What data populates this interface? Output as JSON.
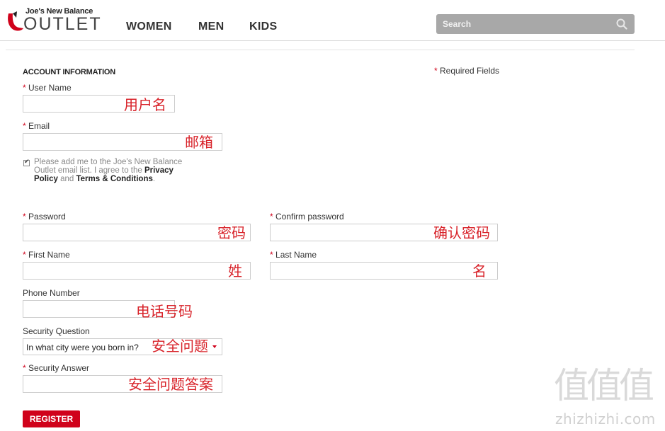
{
  "header": {
    "logo_top": "Joe's New Balance",
    "logo_bottom": "OUTLET",
    "nav": [
      "WOMEN",
      "MEN",
      "KIDS"
    ],
    "search_placeholder": "Search"
  },
  "form": {
    "section_title": "ACCOUNT INFORMATION",
    "required_note": "Required Fields",
    "required_marker": "*",
    "username": {
      "label": "User Name",
      "annotation": "用户名"
    },
    "email": {
      "label": "Email",
      "annotation": "邮箱"
    },
    "consent": {
      "text_1": "Please add me to the Joe's New Balance Outlet email list. I agree to the ",
      "privacy_link": "Privacy Policy",
      "and": " and ",
      "terms_link": "Terms & Conditions",
      "end": ".",
      "checked": true
    },
    "password": {
      "label": "Password",
      "annotation": "密码"
    },
    "confirm_password": {
      "label": "Confirm password",
      "annotation": "确认密码"
    },
    "first_name": {
      "label": "First Name",
      "annotation": "姓"
    },
    "last_name": {
      "label": "Last Name",
      "annotation": "名"
    },
    "phone": {
      "label": "Phone Number",
      "annotation": "电话号码"
    },
    "security_question": {
      "label": "Security Question",
      "value": "In what city were you born in?",
      "annotation": "安全问题"
    },
    "security_answer": {
      "label": "Security Answer",
      "annotation": "安全问题答案"
    },
    "register_label": "REGISTER"
  },
  "watermark": {
    "glyphs": "值值值",
    "text": "zhizhizhi.com"
  },
  "colors": {
    "accent_red": "#d0021b",
    "annotation_red": "#d8232a",
    "search_bg": "#a8a8a8"
  }
}
